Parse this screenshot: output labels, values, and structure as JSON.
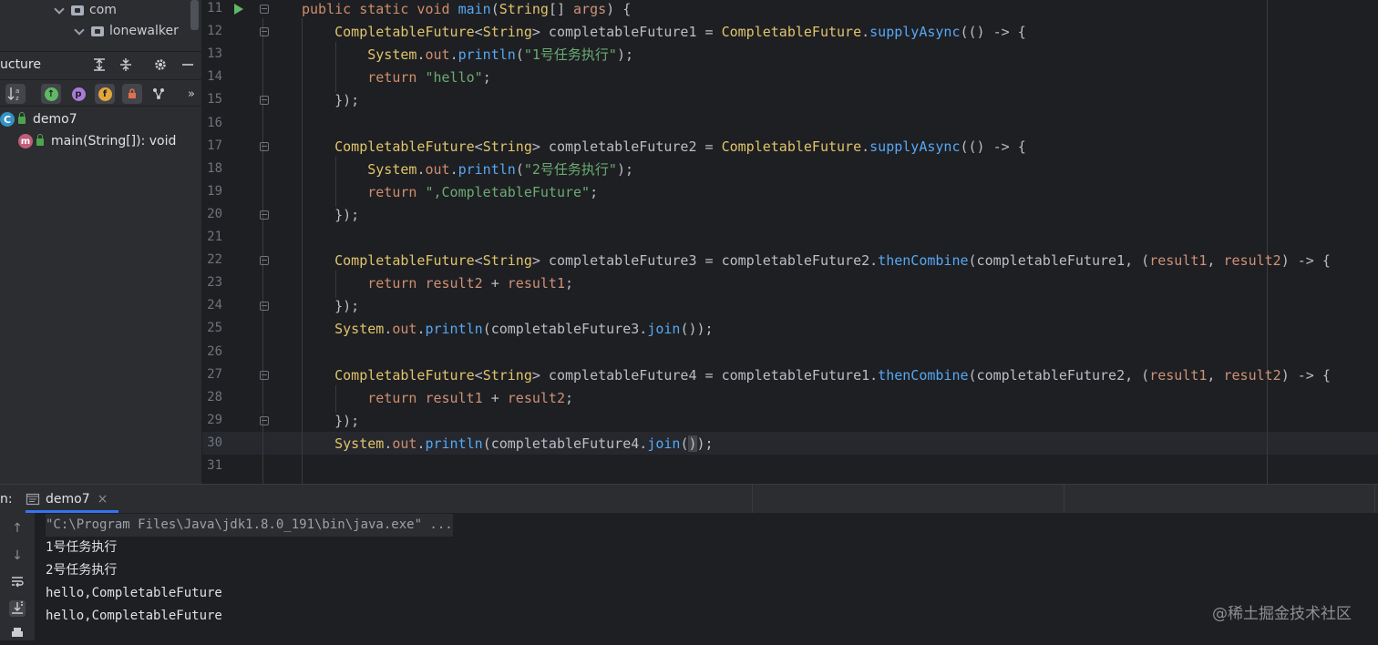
{
  "project_tree": [
    {
      "label": "com"
    },
    {
      "label": "lonewalker"
    }
  ],
  "structure_panel": {
    "title": "ucture",
    "root": {
      "badge": "C",
      "label": "demo7"
    },
    "member": {
      "badge": "m",
      "label": "main(String[]): void"
    },
    "toolbar_badges": {
      "p": "p",
      "f": "f"
    }
  },
  "editor": {
    "line_numbers": [
      "11",
      "12",
      "13",
      "14",
      "15",
      "16",
      "17",
      "18",
      "19",
      "20",
      "21",
      "22",
      "23",
      "24",
      "25",
      "26",
      "27",
      "28",
      "29",
      "30",
      "31"
    ]
  },
  "run_panel": {
    "prefix": "n:",
    "tab_label": "demo7",
    "close_glyph": "×",
    "output": [
      "\"C:\\Program Files\\Java\\jdk1.8.0_191\\bin\\java.exe\" ...",
      "1号任务执行",
      "2号任务执行",
      "hello,CompletableFuture",
      "hello,CompletableFuture"
    ]
  },
  "watermark": "@稀土掘金技术社区",
  "icons": [
    "chevron-down-icon",
    "folder-icon",
    "sort-alpha-icon",
    "expand-all-icon",
    "collapse-all-icon",
    "gear-icon",
    "minimize-icon",
    "run-icon",
    "up-arrow-icon",
    "down-arrow-icon",
    "soft-wrap-icon",
    "scroll-to-end-icon",
    "print-icon"
  ],
  "colors": {
    "keyword": "#cf8e6d",
    "type": "#e0c46c",
    "method": "#56a8f5",
    "string": "#6aab73",
    "field": "#c77dbb",
    "accent": "#3574f0"
  }
}
